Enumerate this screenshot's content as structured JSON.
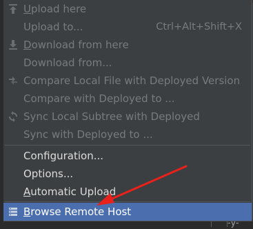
{
  "menu": {
    "items": [
      {
        "label": "Upload here",
        "mnemonic_index": 0,
        "shortcut": "",
        "icon": "upload-icon",
        "enabled": false
      },
      {
        "label": "Upload to...",
        "mnemonic_index": -1,
        "shortcut": "Ctrl+Alt+Shift+X",
        "icon": "",
        "enabled": false
      },
      {
        "label": "Download from here",
        "mnemonic_index": 0,
        "shortcut": "",
        "icon": "download-icon",
        "enabled": false
      },
      {
        "label": "Download from...",
        "mnemonic_index": -1,
        "shortcut": "",
        "icon": "",
        "enabled": false
      },
      {
        "label": "Compare Local File with Deployed Version",
        "mnemonic_index": -1,
        "shortcut": "",
        "icon": "compare-icon",
        "enabled": false
      },
      {
        "label": "Compare with Deployed to ...",
        "mnemonic_index": -1,
        "shortcut": "",
        "icon": "",
        "enabled": false
      },
      {
        "label": "Sync Local Subtree with Deployed",
        "mnemonic_index": -1,
        "shortcut": "",
        "icon": "sync-icon",
        "enabled": false
      },
      {
        "label": "Sync with Deployed to ...",
        "mnemonic_index": -1,
        "shortcut": "",
        "icon": "",
        "enabled": false
      },
      {
        "label": "Configuration...",
        "mnemonic_index": -1,
        "shortcut": "",
        "icon": "",
        "enabled": true
      },
      {
        "label": "Options...",
        "mnemonic_index": -1,
        "shortcut": "",
        "icon": "",
        "enabled": true
      },
      {
        "label": "Automatic Upload",
        "mnemonic_index": 0,
        "shortcut": "",
        "icon": "",
        "enabled": true
      },
      {
        "label": "Browse Remote Host",
        "mnemonic_index": 0,
        "shortcut": "",
        "icon": "remote-host-icon",
        "enabled": true,
        "selected": true
      }
    ]
  },
  "colors": {
    "menu_background": "#3c3f41",
    "selection": "#4b6eaf",
    "enabled_text": "#dcdcdc",
    "disabled_text": "#787b7e",
    "annotation_arrow": "#e8221b"
  },
  "background": {
    "bottom_right_text": "-y-"
  }
}
